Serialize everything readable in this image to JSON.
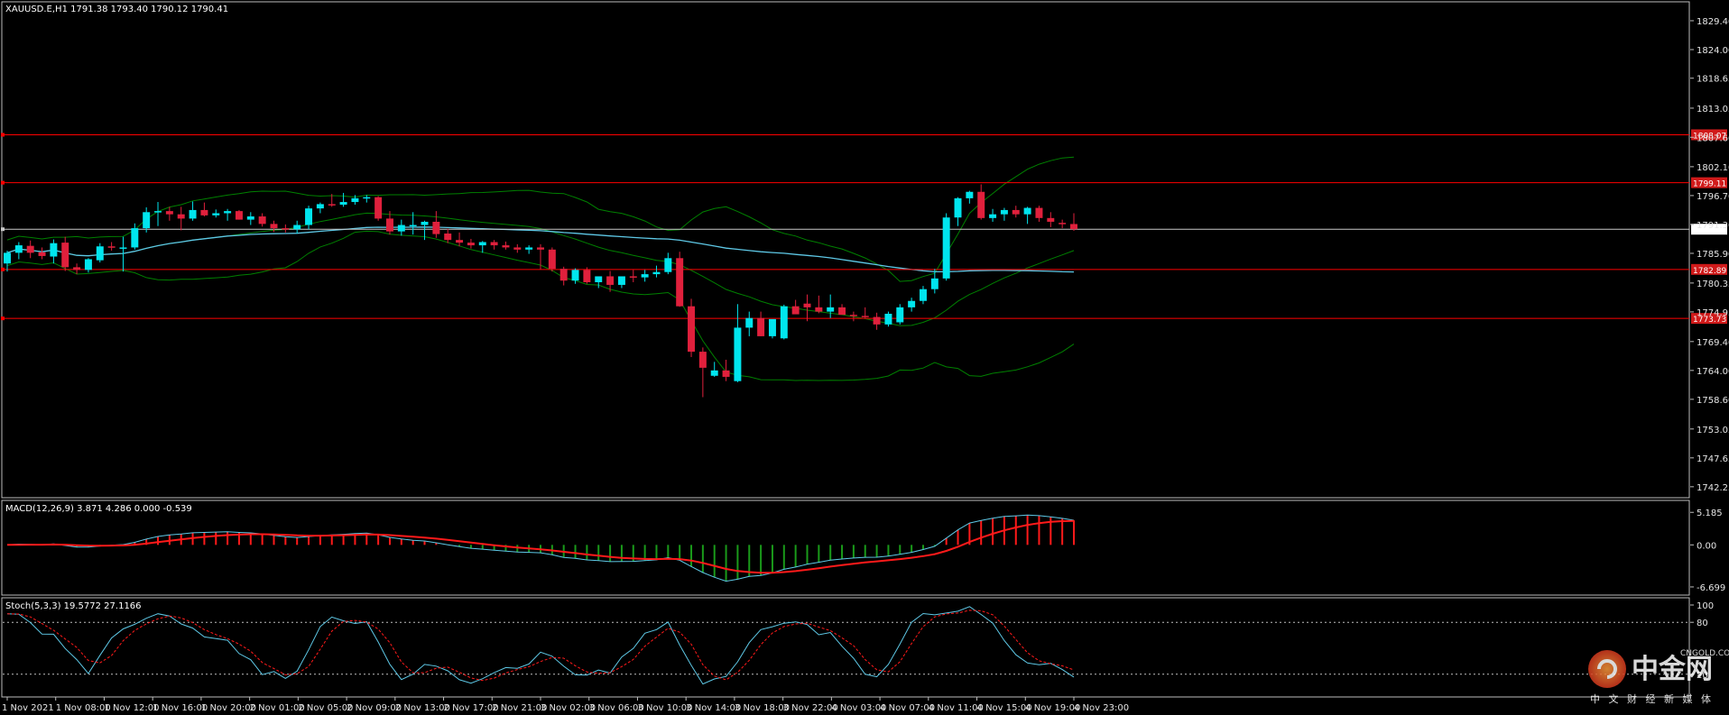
{
  "chart_data": {
    "type": "candlestick",
    "symbol_header": "XAUUSD.E,H1  1791.38 1793.40 1790.12 1790.41",
    "price_axis": {
      "ticks": [
        "1829.40",
        "1824.00",
        "1818.65",
        "1813.05",
        "1807.60",
        "1802.10",
        "1796.70",
        "1791.30",
        "1785.90",
        "1780.35",
        "1774.95",
        "1769.40",
        "1764.00",
        "1758.60",
        "1753.05",
        "1747.65",
        "1742.25"
      ],
      "range": [
        1740.2,
        1832.6
      ]
    },
    "time_labels": [
      "1 Nov 2021",
      "1 Nov 08:00",
      "1 Nov 12:00",
      "1 Nov 16:00",
      "1 Nov 20:00",
      "2 Nov 01:00",
      "2 Nov 05:00",
      "2 Nov 09:00",
      "2 Nov 13:00",
      "2 Nov 17:00",
      "2 Nov 21:00",
      "3 Nov 02:00",
      "3 Nov 06:00",
      "3 Nov 10:00",
      "3 Nov 14:00",
      "3 Nov 18:00",
      "3 Nov 22:00",
      "4 Nov 03:00",
      "4 Nov 07:00",
      "4 Nov 11:00",
      "4 Nov 15:00",
      "4 Nov 19:00",
      "4 Nov 23:00"
    ],
    "horizontal_levels": [
      {
        "price": 1808.07,
        "label": "1808.07",
        "color": "#ff0000"
      },
      {
        "price": 1799.11,
        "label": "1799.11",
        "color": "#ff0000"
      },
      {
        "price": 1790.41,
        "label": "1790.41",
        "color": "#c8c8c8"
      },
      {
        "price": 1782.89,
        "label": "1782.89",
        "color": "#ff0000"
      },
      {
        "price": 1773.73,
        "label": "1773.73",
        "color": "#ff0000"
      }
    ],
    "candles_ohlc": [
      [
        1784.0,
        1786.4,
        1782.5,
        1786.0
      ],
      [
        1786.0,
        1788.0,
        1784.8,
        1787.4
      ],
      [
        1787.3,
        1788.3,
        1785.0,
        1786.0
      ],
      [
        1786.1,
        1787.0,
        1784.8,
        1785.4
      ],
      [
        1785.3,
        1788.5,
        1784.0,
        1787.8
      ],
      [
        1787.9,
        1789.0,
        1782.6,
        1783.3
      ],
      [
        1783.3,
        1784.0,
        1782.0,
        1782.8
      ],
      [
        1782.8,
        1785.0,
        1782.3,
        1784.8
      ],
      [
        1784.6,
        1787.8,
        1784.2,
        1787.2
      ],
      [
        1787.2,
        1788.0,
        1786.4,
        1787.0
      ],
      [
        1787.0,
        1789.0,
        1782.5,
        1787.0
      ],
      [
        1787.0,
        1791.5,
        1786.6,
        1790.6
      ],
      [
        1790.6,
        1794.5,
        1789.8,
        1793.6
      ],
      [
        1793.6,
        1795.5,
        1791.0,
        1793.8
      ],
      [
        1793.8,
        1794.6,
        1792.0,
        1793.2
      ],
      [
        1793.2,
        1794.6,
        1790.2,
        1792.4
      ],
      [
        1792.4,
        1795.6,
        1792.0,
        1794.0
      ],
      [
        1794.0,
        1795.4,
        1792.8,
        1793.0
      ],
      [
        1793.0,
        1794.1,
        1792.6,
        1793.4
      ],
      [
        1793.4,
        1794.2,
        1792.0,
        1793.8
      ],
      [
        1793.8,
        1794.0,
        1792.2,
        1792.2
      ],
      [
        1792.2,
        1793.6,
        1791.2,
        1792.8
      ],
      [
        1792.8,
        1793.4,
        1790.9,
        1791.4
      ],
      [
        1791.4,
        1792.0,
        1789.9,
        1790.6
      ],
      [
        1790.6,
        1791.3,
        1789.8,
        1790.4
      ],
      [
        1790.4,
        1792.0,
        1789.6,
        1791.2
      ],
      [
        1791.2,
        1794.8,
        1790.4,
        1794.3
      ],
      [
        1794.3,
        1795.4,
        1793.4,
        1795.1
      ],
      [
        1795.1,
        1797.0,
        1794.6,
        1795.0
      ],
      [
        1795.0,
        1797.2,
        1794.6,
        1795.5
      ],
      [
        1795.5,
        1796.8,
        1795.0,
        1796.2
      ],
      [
        1796.2,
        1796.8,
        1795.4,
        1796.4
      ],
      [
        1796.4,
        1796.6,
        1792.0,
        1792.4
      ],
      [
        1792.4,
        1793.8,
        1789.4,
        1790.0
      ],
      [
        1790.0,
        1792.2,
        1789.2,
        1791.2
      ],
      [
        1791.2,
        1793.6,
        1789.4,
        1791.2
      ],
      [
        1791.2,
        1792.0,
        1788.4,
        1791.8
      ],
      [
        1791.8,
        1793.8,
        1788.8,
        1789.5
      ],
      [
        1789.6,
        1790.5,
        1787.8,
        1788.4
      ],
      [
        1788.4,
        1789.8,
        1787.2,
        1787.9
      ],
      [
        1787.9,
        1788.6,
        1786.8,
        1787.4
      ],
      [
        1787.4,
        1788.2,
        1786.0,
        1788.0
      ],
      [
        1788.0,
        1788.4,
        1786.6,
        1787.4
      ],
      [
        1787.4,
        1788.1,
        1786.6,
        1787.0
      ],
      [
        1787.0,
        1787.6,
        1786.0,
        1786.6
      ],
      [
        1786.6,
        1787.4,
        1785.8,
        1787.0
      ],
      [
        1787.0,
        1787.6,
        1782.9,
        1786.6
      ],
      [
        1786.6,
        1787.0,
        1782.5,
        1783.0
      ],
      [
        1783.0,
        1783.4,
        1779.9,
        1780.8
      ],
      [
        1780.8,
        1783.1,
        1780.2,
        1782.8
      ],
      [
        1782.8,
        1783.3,
        1780.2,
        1780.5
      ],
      [
        1780.5,
        1781.4,
        1779.4,
        1781.6
      ],
      [
        1781.6,
        1782.6,
        1778.7,
        1780.0
      ],
      [
        1780.0,
        1781.5,
        1779.4,
        1781.6
      ],
      [
        1781.6,
        1782.8,
        1780.5,
        1781.4
      ],
      [
        1781.4,
        1782.8,
        1780.6,
        1782.0
      ],
      [
        1782.0,
        1783.6,
        1781.4,
        1782.4
      ],
      [
        1782.4,
        1786.0,
        1782.0,
        1785.0
      ],
      [
        1785.0,
        1786.2,
        1775.9,
        1776.0
      ],
      [
        1776.0,
        1777.4,
        1766.5,
        1767.5
      ],
      [
        1767.5,
        1768.3,
        1759.0,
        1764.5
      ],
      [
        1763.0,
        1765.6,
        1762.8,
        1764.0
      ],
      [
        1764.0,
        1766.0,
        1762.0,
        1762.8
      ],
      [
        1762.0,
        1776.4,
        1761.8,
        1772.0
      ],
      [
        1772.0,
        1775.0,
        1770.4,
        1773.8
      ],
      [
        1773.8,
        1775.0,
        1770.4,
        1770.4
      ],
      [
        1770.4,
        1773.4,
        1770.0,
        1773.6
      ],
      [
        1770.0,
        1776.3,
        1769.8,
        1776.0
      ],
      [
        1776.0,
        1777.2,
        1774.6,
        1774.5
      ],
      [
        1776.5,
        1778.2,
        1773.2,
        1775.8
      ],
      [
        1775.8,
        1778.0,
        1774.7,
        1775.0
      ],
      [
        1775.0,
        1778.2,
        1773.8,
        1775.8
      ],
      [
        1775.8,
        1776.4,
        1774.6,
        1774.4
      ],
      [
        1774.4,
        1775.0,
        1773.2,
        1774.2
      ],
      [
        1774.2,
        1775.8,
        1773.8,
        1774.0
      ],
      [
        1774.0,
        1774.8,
        1771.6,
        1772.6
      ],
      [
        1772.6,
        1775.0,
        1772.2,
        1774.6
      ],
      [
        1773.0,
        1776.4,
        1772.6,
        1775.8
      ],
      [
        1775.8,
        1777.6,
        1775.0,
        1777.0
      ],
      [
        1777.0,
        1779.8,
        1776.4,
        1779.2
      ],
      [
        1779.2,
        1783.0,
        1778.4,
        1781.2
      ],
      [
        1781.2,
        1793.4,
        1780.8,
        1792.6
      ],
      [
        1792.6,
        1796.4,
        1791.0,
        1796.2
      ],
      [
        1796.2,
        1797.6,
        1795.2,
        1797.4
      ],
      [
        1797.4,
        1798.8,
        1792.2,
        1792.5
      ],
      [
        1792.5,
        1794.2,
        1791.8,
        1793.2
      ],
      [
        1793.2,
        1794.4,
        1792.0,
        1794.0
      ],
      [
        1794.0,
        1794.8,
        1792.6,
        1793.2
      ],
      [
        1793.2,
        1794.6,
        1791.4,
        1794.4
      ],
      [
        1794.4,
        1794.8,
        1791.8,
        1792.5
      ],
      [
        1792.5,
        1793.6,
        1790.8,
        1791.8
      ],
      [
        1791.6,
        1792.2,
        1790.6,
        1791.4
      ],
      [
        1791.38,
        1793.4,
        1790.12,
        1790.41
      ]
    ],
    "overlays": [
      {
        "type": "bollinger",
        "color": "#008000"
      },
      {
        "type": "moving_average",
        "color": "#60d0e8"
      }
    ],
    "macd": {
      "header": "MACD(12,26,9) 3.871 4.286 0.000 -0.539",
      "ticks": [
        "5.185",
        "0.00",
        "-6.699"
      ],
      "range": [
        -8.0,
        6.8
      ]
    },
    "stochastic": {
      "header": "Stoch(5,3,3) 19.5772 27.1166",
      "ticks": [
        "100",
        "80",
        "20"
      ],
      "levels": [
        80,
        20
      ]
    },
    "colors": {
      "bull": "#00e5ee",
      "bear": "#e0203c",
      "macd_pos": "#ff1a1a",
      "macd_neg": "#1a9a1a",
      "signal": "#ff1a1a",
      "main_line": "#5ec8e6",
      "grid": "#8a8a8a"
    }
  },
  "watermark": {
    "brand": "中金网",
    "tagline": "中 文 财 经 新 媒 体",
    "site": "CNGOLD.COM"
  }
}
